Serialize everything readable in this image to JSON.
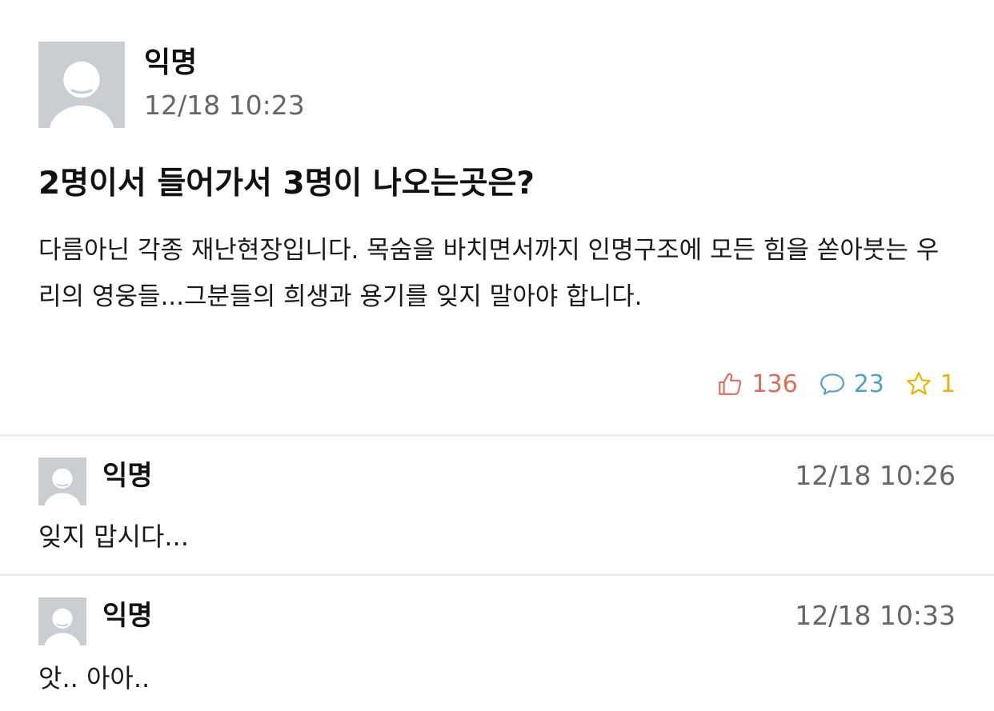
{
  "post": {
    "author": "익명",
    "time": "12/18 10:23",
    "title": "2명이서 들어가서 3명이 나오는곳은?",
    "body": "다름아닌 각종 재난현장입니다. 목숨을 바치면서까지 인명구조에 모든 힘을 쏟아붓는 우리의 영웅들...그분들의 희생과 용기를 잊지 말아야 합니다.",
    "stats": {
      "likes": "136",
      "comments": "23",
      "scraps": "1"
    },
    "avatar_icon": "anonymous-avatar-icon"
  },
  "comments": [
    {
      "author": "익명",
      "time": "12/18 10:26",
      "text": "잊지 맙시다..."
    },
    {
      "author": "익명",
      "time": "12/18 10:33",
      "text": "앗.. 아아.."
    }
  ],
  "colors": {
    "like": "#d96e5a",
    "comment": "#4ea3c4",
    "scrap": "#e8b300",
    "avatar_bg": "#c9ced3",
    "muted_text": "#666666",
    "divider": "#eeeeee"
  },
  "icons": {
    "like": "thumbs-up-icon",
    "comment": "speech-bubble-icon",
    "scrap": "star-icon"
  }
}
